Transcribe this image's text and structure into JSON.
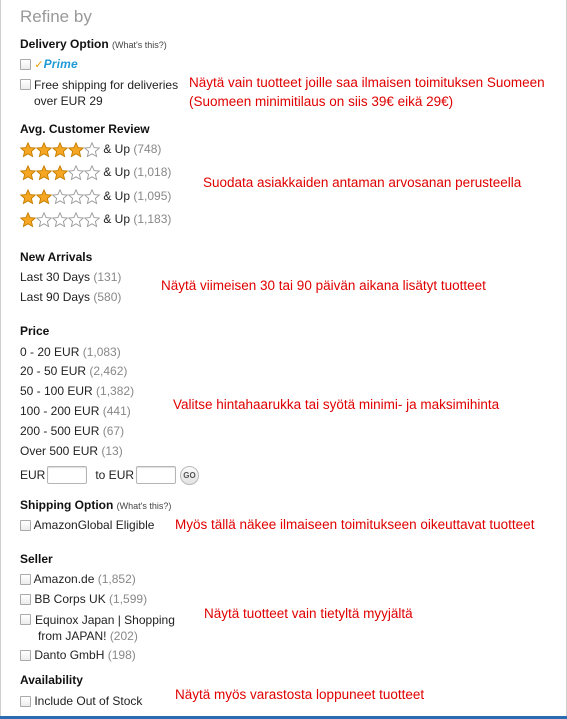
{
  "refine": {
    "title": "Refine by"
  },
  "delivery": {
    "title": "Delivery Option",
    "whats_this": "(What's this?)",
    "prime_label": "Prime",
    "free_shipping_line1": "Free shipping for deliveries",
    "free_shipping_line2": "over EUR 29"
  },
  "review": {
    "title": "Avg. Customer Review",
    "and_up": "& Up",
    "items": [
      {
        "stars": 4,
        "count": "(748)"
      },
      {
        "stars": 3,
        "count": "(1,018)"
      },
      {
        "stars": 2,
        "count": "(1,095)"
      },
      {
        "stars": 1,
        "count": "(1,183)"
      }
    ]
  },
  "arrivals": {
    "title": "New Arrivals",
    "items": [
      {
        "label": "Last 30 Days",
        "count": "(131)"
      },
      {
        "label": "Last 90 Days",
        "count": "(580)"
      }
    ]
  },
  "price": {
    "title": "Price",
    "items": [
      {
        "label": "0 - 20 EUR",
        "count": "(1,083)"
      },
      {
        "label": "20 - 50 EUR",
        "count": "(2,462)"
      },
      {
        "label": "50 - 100 EUR",
        "count": "(1,382)"
      },
      {
        "label": "100 - 200 EUR",
        "count": "(441)"
      },
      {
        "label": "200 - 500 EUR",
        "count": "(67)"
      },
      {
        "label": "Over 500 EUR",
        "count": "(13)"
      }
    ],
    "from_label": "EUR",
    "to_label": "to EUR",
    "min_value": "",
    "max_value": "",
    "go_label": "GO"
  },
  "shipping": {
    "title": "Shipping Option",
    "whats_this": "(What's this?)",
    "global_label": "AmazonGlobal Eligible"
  },
  "seller": {
    "title": "Seller",
    "items": [
      {
        "label": "Amazon.de",
        "count": "(1,852)"
      },
      {
        "label": "BB Corps UK",
        "count": "(1,599)"
      },
      {
        "label_line1": "Equinox Japan | Shopping",
        "label_line2": "from JAPAN!",
        "count": "(202)"
      },
      {
        "label": "Danto GmbH",
        "count": "(198)"
      }
    ]
  },
  "availability": {
    "title": "Availability",
    "include_oos": "Include Out of Stock"
  },
  "notes": {
    "delivery_line1": "Näytä vain tuotteet joille saa ilmaisen toimituksen Suomeen",
    "delivery_line2": "(Suomeen minimitilaus on siis 39€ eikä 29€)",
    "review": "Suodata asiakkaiden antaman arvosanan perusteella",
    "arrivals": "Näytä viimeisen 30 tai 90 päivän aikana lisätyt tuotteet",
    "price": "Valitse hintahaarukka tai syötä minimi- ja maksimihinta",
    "shipping": "Myös tällä näkee ilmaiseen toimitukseen oikeuttavat tuotteet",
    "seller": "Näytä tuotteet vain tietyltä myyjältä",
    "availability": "Näytä myös varastosta loppuneet tuotteet"
  },
  "colors": {
    "star_fill": "#f5a623",
    "star_outline": "#9a9a9a",
    "note_red": "#e00000",
    "prime_blue": "#1f9ad6"
  }
}
